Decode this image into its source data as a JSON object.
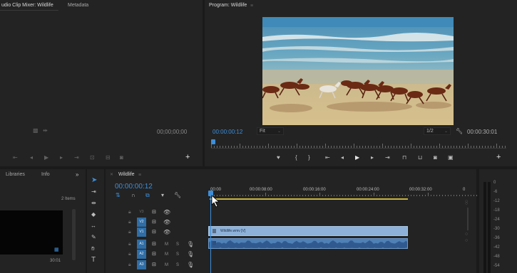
{
  "source_panel": {
    "tabs": [
      "udio Clip Mixer: Wildlife",
      "Metadata"
    ],
    "timecode": "00;00;00;00"
  },
  "program_monitor": {
    "title": "Program: Wildlife",
    "menu_icon": "hamburger-icon",
    "timecode_current": "00:00:00:12",
    "fit_label": "Fit",
    "resolution": "1/2",
    "timecode_duration": "00:00:30:01",
    "transport_icons": [
      "marker-icon",
      "in-point-icon",
      "out-point-icon",
      "go-to-in-icon",
      "step-back-icon",
      "play-icon",
      "step-forward-icon",
      "go-to-out-icon",
      "lift-icon",
      "extract-icon",
      "camera-icon",
      "button-editor-icon"
    ]
  },
  "project_panel": {
    "tabs": [
      "Libraries",
      "Info"
    ],
    "more_icon": "double-chevron-icon",
    "items_count": "2 Items",
    "thumb_duration": "30:01"
  },
  "tools": [
    "selection-tool-icon",
    "track-select-icon",
    "ripple-edit-icon",
    "razor-icon",
    "slip-icon",
    "pen-icon",
    "hand-icon",
    "type-icon"
  ],
  "timeline": {
    "title": "Wildlife",
    "menu_icon": "hamburger-icon",
    "timecode": "00:00:00:12",
    "ruler_labels": [
      "00:00",
      "00:00:08:00",
      "00:00:16:00",
      "00:00:24:00",
      "00:00:32:00",
      "0"
    ],
    "tracks": [
      {
        "src": "",
        "name": "V3",
        "selected": false
      },
      {
        "src": "V2",
        "name": "V2",
        "selected": true
      },
      {
        "src": "V1",
        "name": "V1",
        "selected": true
      },
      {
        "src": "A1",
        "name": "A1",
        "selected": true
      },
      {
        "src": "A2",
        "name": "A2",
        "selected": true
      },
      {
        "src": "A3",
        "name": "A3",
        "selected": true
      }
    ],
    "audio_labels": [
      "M",
      "S"
    ],
    "clip_name": "Wildlife.wmv [V]"
  },
  "audio_meter": {
    "scale": [
      "0",
      "-6",
      "-12",
      "-18",
      "-24",
      "-30",
      "-36",
      "-42",
      "-48",
      "-54"
    ]
  },
  "colors": {
    "accent_blue": "#3e8ed8",
    "clip_blue": "#8db1d8",
    "audio_clip": "#5b8cc4",
    "work_area": "#c8b43a"
  }
}
